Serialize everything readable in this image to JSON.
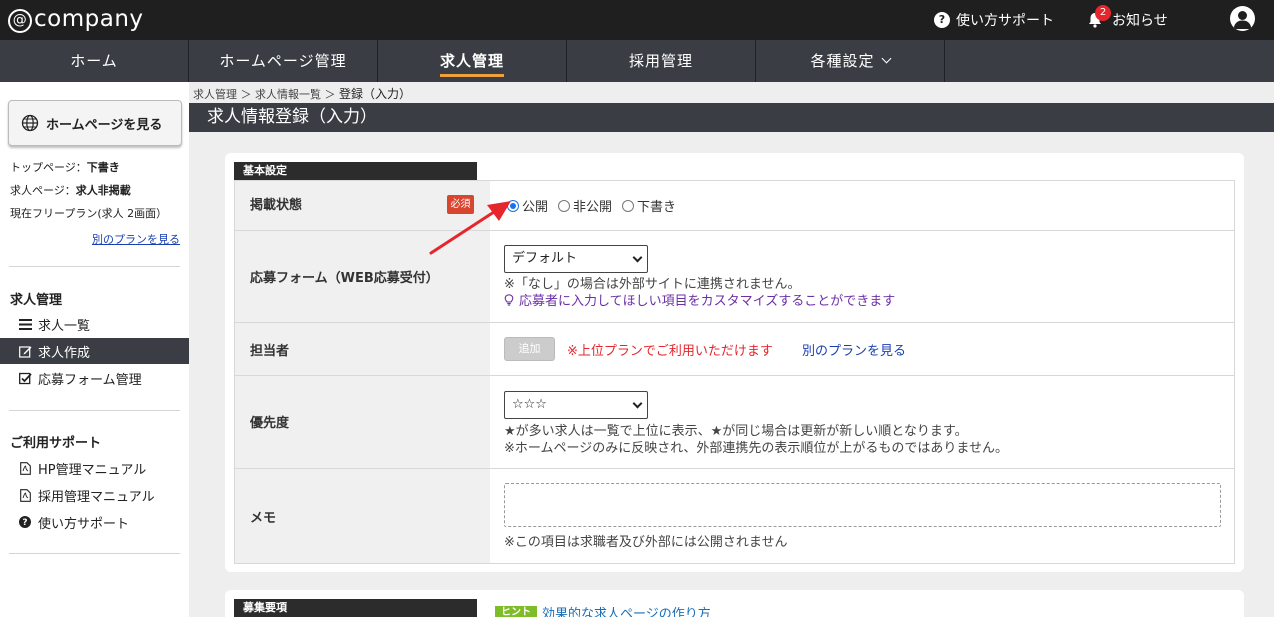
{
  "header": {
    "logo_at": "@",
    "logo_text": "company",
    "support_label": "使い方サポート",
    "notice_label": "お知らせ",
    "notice_count": "2"
  },
  "nav": {
    "items": [
      {
        "label": "ホーム"
      },
      {
        "label": "ホームページ管理"
      },
      {
        "label": "求人管理"
      },
      {
        "label": "採用管理"
      },
      {
        "label": "各種設定"
      }
    ]
  },
  "sidebar": {
    "view_hp_label": "ホームページを見る",
    "top_page_label": "トップページ：",
    "top_page_value": "下書き",
    "job_page_label": "求人ページ：",
    "job_page_value": "求人非掲載",
    "plan_text": "現在フリープラン(求人 2画面）",
    "other_plan_link": "別のプランを見る",
    "job_section_title": "求人管理",
    "job_items": [
      {
        "label": "求人一覧"
      },
      {
        "label": "求人作成"
      },
      {
        "label": "応募フォーム管理"
      }
    ],
    "support_section_title": "ご利用サポート",
    "support_items": [
      {
        "label": "HP管理マニュアル"
      },
      {
        "label": "採用管理マニュアル"
      },
      {
        "label": "使い方サポート"
      }
    ]
  },
  "breadcrumb": {
    "crumb1": "求人管理",
    "sep1": "＞",
    "crumb2": "求人情報一覧",
    "sep2": "＞",
    "current": "登録（入力）"
  },
  "page_title": "求人情報登録（入力）",
  "basic": {
    "section_title": "基本設定",
    "status": {
      "label": "掲載状態",
      "required": "必須",
      "options": [
        {
          "label": "公開",
          "selected": true
        },
        {
          "label": "非公開",
          "selected": false
        },
        {
          "label": "下書き",
          "selected": false
        }
      ]
    },
    "form": {
      "label": "応募フォーム（WEB応募受付）",
      "value": "デフォルト",
      "note": "※「なし」の場合は外部サイトに連携されません。",
      "link": "応募者に入力してほしい項目をカスタマイズすることができます"
    },
    "person": {
      "label": "担当者",
      "add_button": "追加",
      "upper_plan_note": "※上位プランでご利用いただけます",
      "other_plan_link": "別のプランを見る"
    },
    "priority": {
      "label": "優先度",
      "value": "☆☆☆",
      "note1": "★が多い求人は一覧で上位に表示、★が同じ場合は更新が新しい順となります。",
      "note2": "※ホームページのみに反映され、外部連携先の表示順位が上がるものではありません。"
    },
    "memo": {
      "label": "メモ",
      "note": "※この項目は求職者及び外部には公開されません"
    }
  },
  "recruit": {
    "section_title": "募集要項",
    "hint_badge": "ヒント",
    "hint_link": "効果的な求人ページの作り方"
  },
  "colors": {
    "header_bg": "#1f1f1f",
    "nav_bg": "#3a3e44",
    "accent": "#f0a03a",
    "required": "#d9462f",
    "arrow": "#e5262d"
  }
}
